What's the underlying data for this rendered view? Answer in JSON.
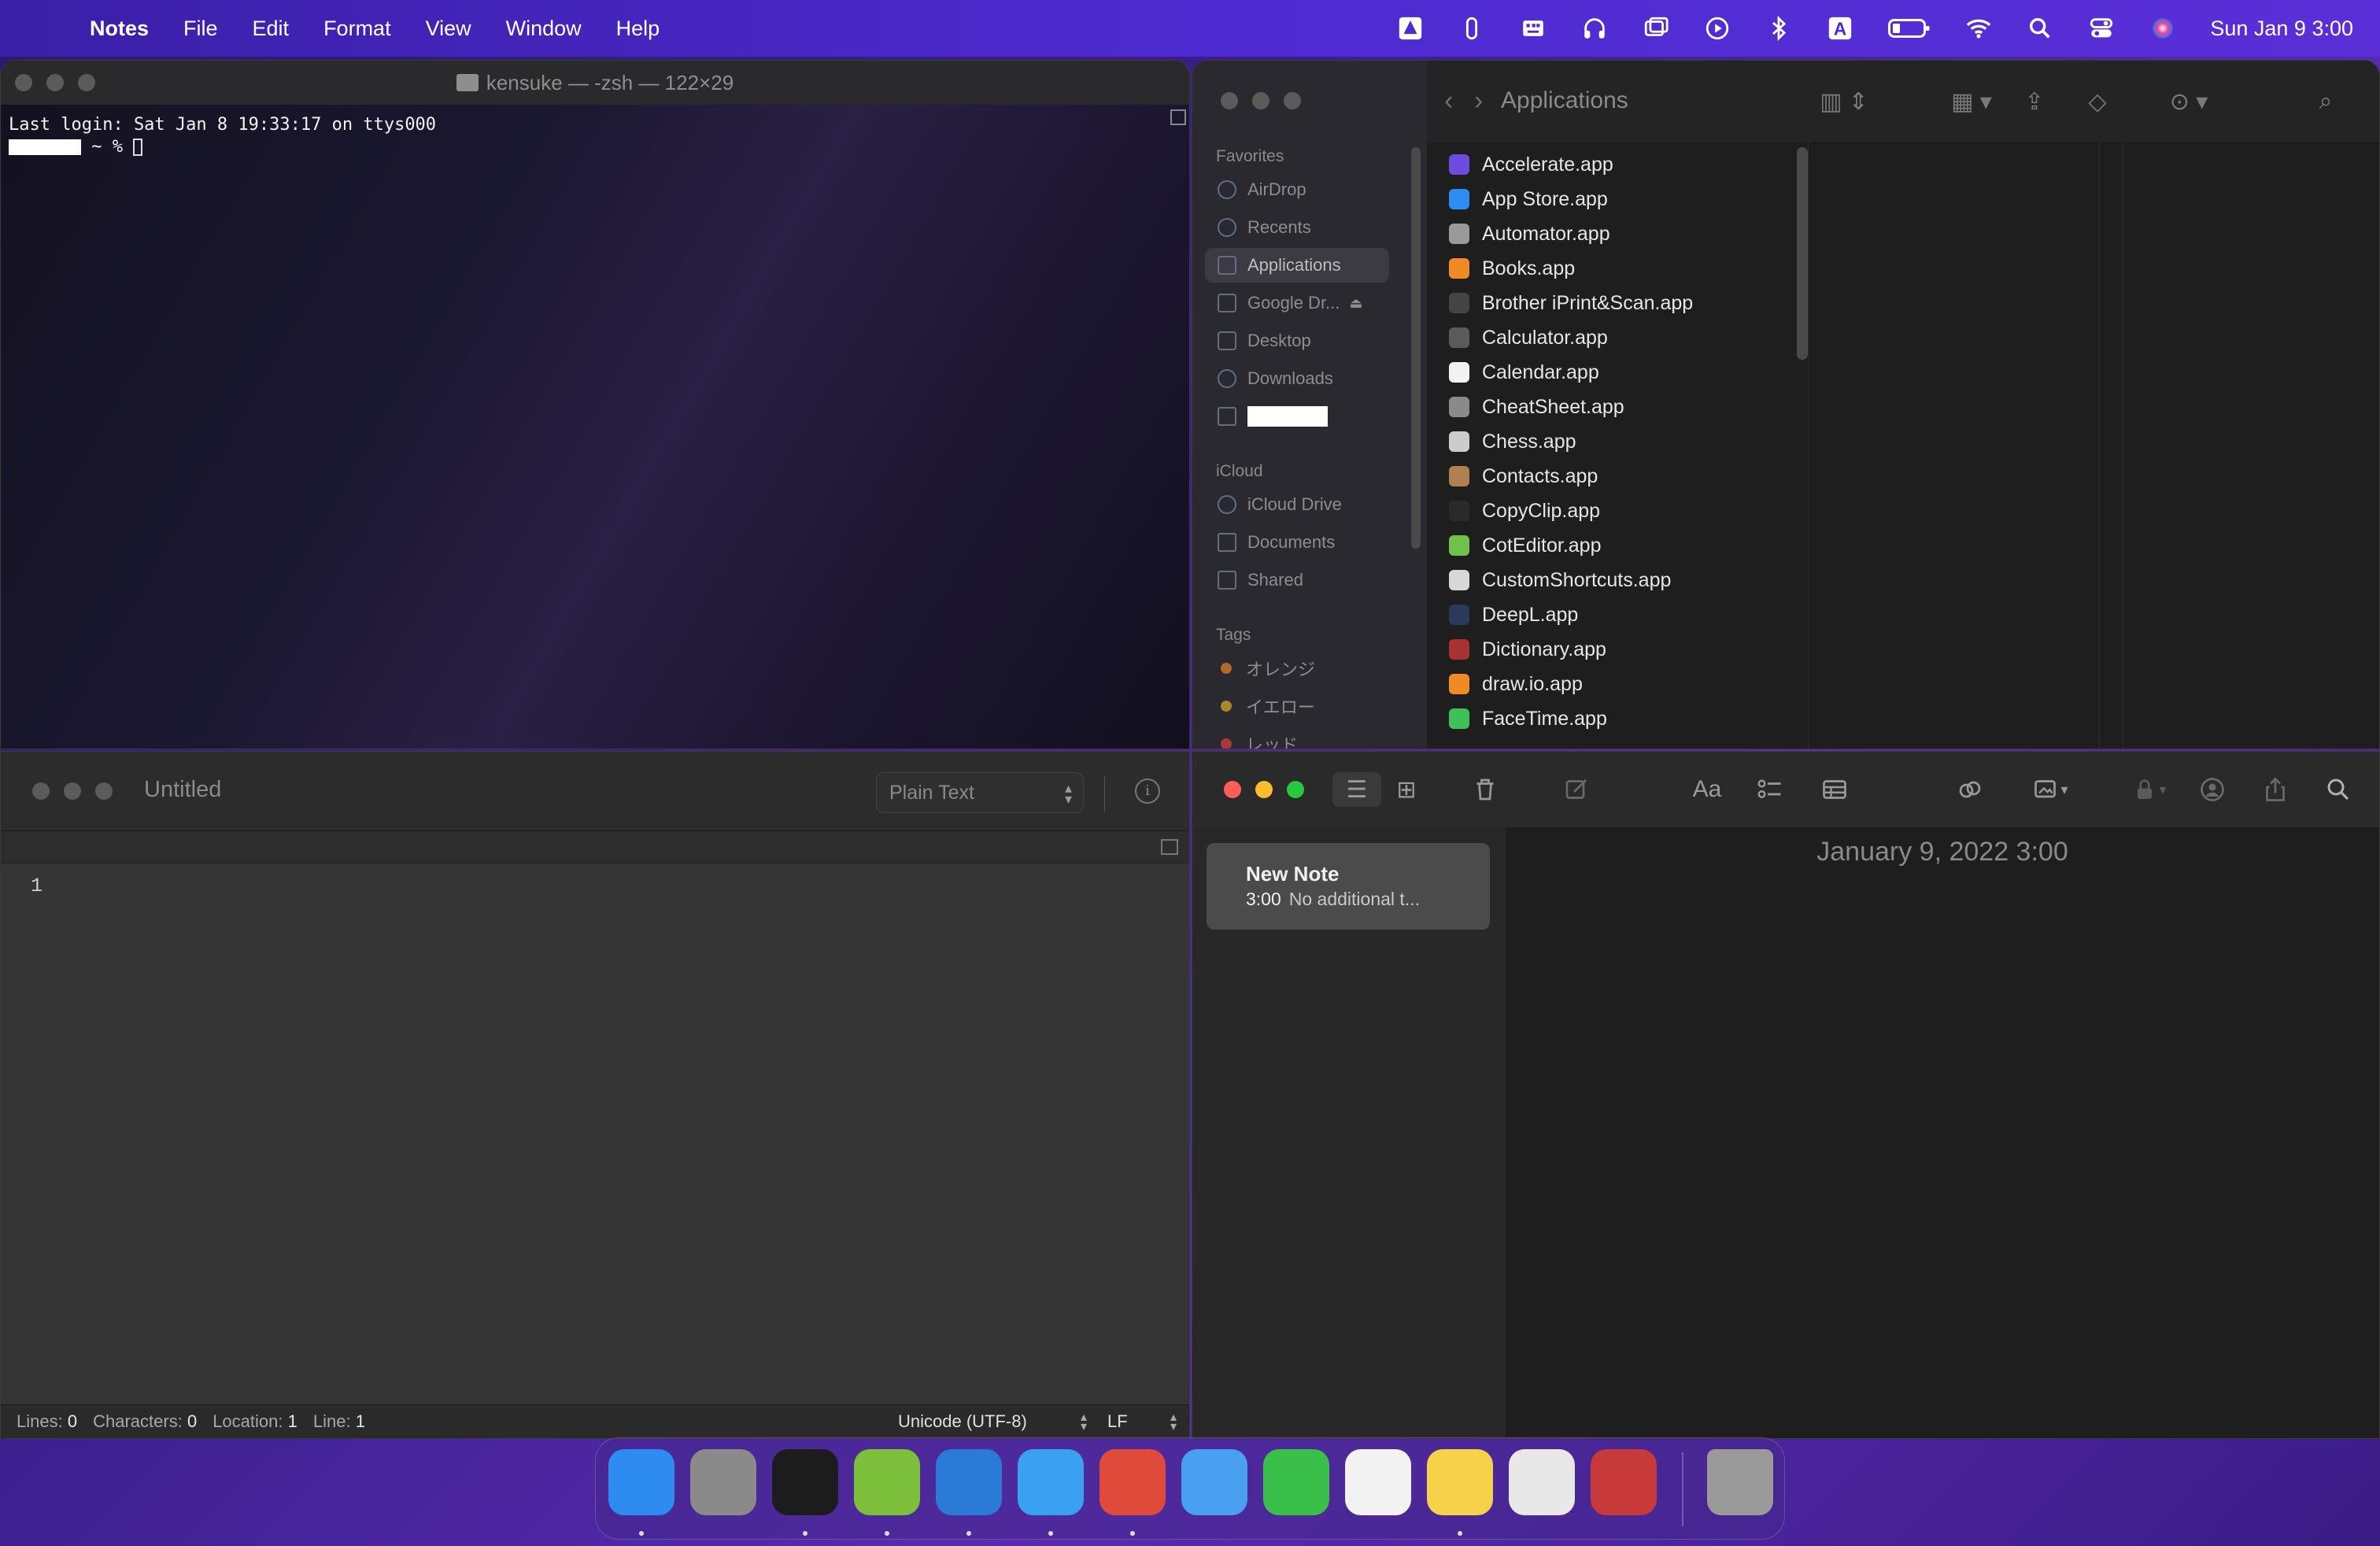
{
  "menubar": {
    "app_name": "Notes",
    "menus": [
      "File",
      "Edit",
      "Format",
      "View",
      "Window",
      "Help"
    ],
    "clock": "Sun Jan 9  3:00",
    "status_icons": [
      "drive-icon",
      "paperclip-icon",
      "keyboard-icon",
      "headphones-icon",
      "screen-mirroring-icon",
      "play-icon",
      "bluetooth-icon",
      "input-source-icon",
      "battery-icon",
      "wifi-icon",
      "spotlight-icon",
      "control-center-icon",
      "siri-icon"
    ],
    "input_source_label": "A"
  },
  "terminal": {
    "title": "kensuke — -zsh — 122×29",
    "line1": "Last login: Sat Jan  8 19:33:17 on ttys000",
    "prompt": "~ %"
  },
  "finder": {
    "path_title": "Applications",
    "sidebar": {
      "favorites_heading": "Favorites",
      "favorites": [
        "AirDrop",
        "Recents",
        "Applications",
        "Google Dr...",
        "Desktop",
        "Downloads"
      ],
      "icloud_heading": "iCloud",
      "icloud": [
        "iCloud Drive",
        "Documents",
        "Shared"
      ],
      "tags_heading": "Tags",
      "tags": [
        {
          "label": "オレンジ",
          "color": "#b06a2a"
        },
        {
          "label": "イエロー",
          "color": "#a8892a"
        },
        {
          "label": "レッド",
          "color": "#a83a3a"
        }
      ]
    },
    "apps": [
      {
        "name": "Accelerate.app",
        "color": "#6e4adf"
      },
      {
        "name": "App Store.app",
        "color": "#2f8cf0"
      },
      {
        "name": "Automator.app",
        "color": "#9a9a9a"
      },
      {
        "name": "Books.app",
        "color": "#f08a24"
      },
      {
        "name": "Brother iPrint&Scan.app",
        "color": "#444444"
      },
      {
        "name": "Calculator.app",
        "color": "#5a5a5a"
      },
      {
        "name": "Calendar.app",
        "color": "#f2f2f2"
      },
      {
        "name": "CheatSheet.app",
        "color": "#8a8a8a"
      },
      {
        "name": "Chess.app",
        "color": "#cccccc"
      },
      {
        "name": "Contacts.app",
        "color": "#b08050"
      },
      {
        "name": "CopyClip.app",
        "color": "#2a2a2a"
      },
      {
        "name": "CotEditor.app",
        "color": "#6fc24a"
      },
      {
        "name": "CustomShortcuts.app",
        "color": "#d8d8d8"
      },
      {
        "name": "DeepL.app",
        "color": "#2a3a5a"
      },
      {
        "name": "Dictionary.app",
        "color": "#a83232"
      },
      {
        "name": "draw.io.app",
        "color": "#f08a24"
      },
      {
        "name": "FaceTime.app",
        "color": "#3fc15a"
      }
    ]
  },
  "editor": {
    "title": "Untitled",
    "syntax": "Plain Text",
    "line_number": "1",
    "status": {
      "lines_label": "Lines:",
      "lines": "0",
      "chars_label": "Characters:",
      "chars": "0",
      "location_label": "Location:",
      "location": "1",
      "line_label": "Line:",
      "line": "1",
      "encoding": "Unicode (UTF-8)",
      "line_ending": "LF"
    }
  },
  "notes": {
    "note_title": "New Note",
    "note_time": "3:00",
    "note_preview": "No additional t...",
    "date_header": "January 9, 2022 3:00",
    "font_button": "Aa"
  },
  "dock": {
    "apps": [
      {
        "name": "finder-icon",
        "color": "#2e8cf0",
        "running": true
      },
      {
        "name": "system-preferences-icon",
        "color": "#8a8a8a",
        "running": false
      },
      {
        "name": "terminal-icon",
        "color": "#1c1c1c",
        "running": true
      },
      {
        "name": "script-editor-icon",
        "color": "#7bbf3a",
        "running": true
      },
      {
        "name": "vscode-icon",
        "color": "#2a7ad6",
        "running": true
      },
      {
        "name": "safari-icon",
        "color": "#3aa0f0",
        "running": true
      },
      {
        "name": "chrome-icon",
        "color": "#e04a3a",
        "running": true
      },
      {
        "name": "mail-icon",
        "color": "#4aa0f0",
        "running": false
      },
      {
        "name": "line-icon",
        "color": "#3ac04a",
        "running": false
      },
      {
        "name": "slack-icon",
        "color": "#f2f2f2",
        "running": false
      },
      {
        "name": "notes-icon",
        "color": "#f6d24a",
        "running": true
      },
      {
        "name": "textedit-icon",
        "color": "#e8e8e8",
        "running": false
      },
      {
        "name": "zotero-icon",
        "color": "#c83a3a",
        "running": false
      }
    ],
    "trash": {
      "name": "trash-icon",
      "color": "#9a9a9a"
    }
  }
}
